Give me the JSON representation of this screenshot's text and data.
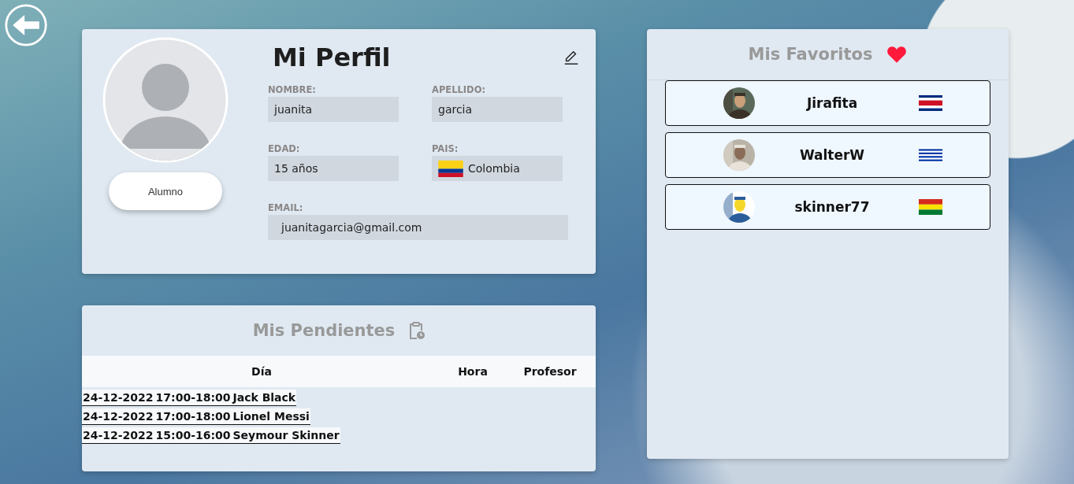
{
  "profile": {
    "title": "Mi Perfil",
    "role": "Alumno",
    "fields": [
      {
        "label": "NOMBRE:",
        "value": "juanita"
      },
      {
        "label": "APELLIDO:",
        "value": "garcia"
      },
      {
        "label": "EDAD:",
        "value": "15 años"
      },
      {
        "label": "PAIS:",
        "value": "Colombia",
        "flag": {
          "kind": "co"
        }
      },
      {
        "label": "EMAIL:",
        "value": "juanitagarcia@gmail.com",
        "kind": "wide"
      }
    ]
  },
  "pending": {
    "title": "Mis Pendientes",
    "headings": [
      "Día",
      "Hora",
      "Profesor"
    ],
    "entries": [
      {
        "date": "24-12-2022",
        "time": "17:00-18:00",
        "teacher": "Jack Black"
      },
      {
        "date": "24-12-2022",
        "time": "17:00-18:00",
        "teacher": "Lionel Messi"
      },
      {
        "date": "24-12-2022",
        "time": "15:00-16:00",
        "teacher": "Seymour Skinner"
      }
    ]
  },
  "favorites": {
    "title": "Mis Favoritos",
    "items": [
      {
        "name": "Jirafita",
        "flag": {
          "kind": "cr"
        },
        "kind": "picture"
      },
      {
        "name": "WalterW",
        "flag": {
          "kind": "uy"
        },
        "kind": "picture"
      },
      {
        "name": "skinner77",
        "flag": {
          "kind": "bo"
        },
        "kind": "picture"
      }
    ]
  }
}
